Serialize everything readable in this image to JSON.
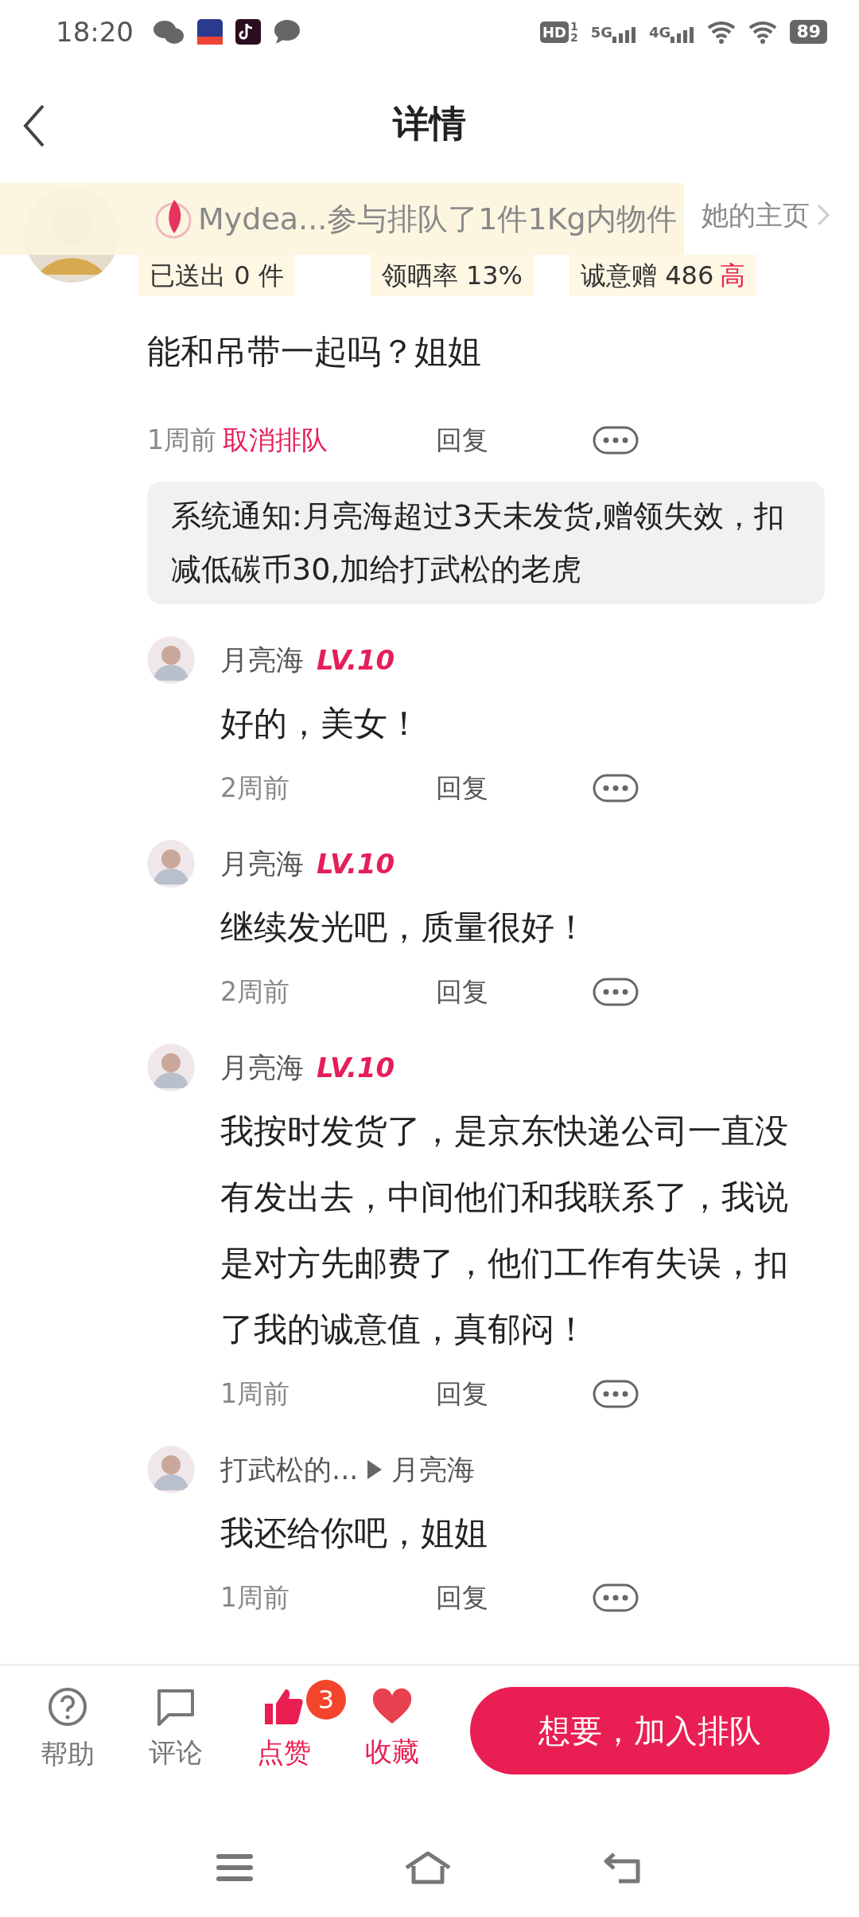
{
  "status_bar": {
    "time": "18:20",
    "hd": {
      "label": "HD",
      "sims": [
        "1",
        "2"
      ]
    },
    "networks": [
      "5G",
      "4G"
    ],
    "battery": "89"
  },
  "header": {
    "title": "详情"
  },
  "poster": {
    "home_link": "她的主页",
    "stats": [
      {
        "label": "已送出 0 件"
      },
      {
        "label": "领晒率 13%"
      },
      {
        "label": "诚意赠 486",
        "tag": "高"
      }
    ]
  },
  "banner": {
    "text": "Mydea...参与排队了1件1Kg内物件"
  },
  "post": {
    "text": "能和吊带一起吗？姐姐",
    "time": "1周前",
    "cancel": "取消排队",
    "reply": "回复"
  },
  "notice": {
    "text": "系统通知:月亮海超过3天未发货,赠领失效，扣减低碳币30,加给打武松的老虎"
  },
  "replies": [
    {
      "name": "月亮海",
      "level": "LV.10",
      "text": "好的，美女！",
      "time": "2周前",
      "reply": "回复"
    },
    {
      "name": "月亮海",
      "level": "LV.10",
      "text": "继续发光吧，质量很好！",
      "time": "2周前",
      "reply": "回复"
    },
    {
      "name": "月亮海",
      "level": "LV.10",
      "text": "我按时发货了，是京东快递公司一直没有发出去，中间他们和我联系了，我说是对方先邮费了，他们工作有失误，扣了我的诚意值，真郁闷！",
      "time": "1周前",
      "reply": "回复"
    },
    {
      "name": "打武松的...",
      "to": "月亮海",
      "text": "我还给你吧，姐姐",
      "time": "1周前",
      "reply": "回复"
    }
  ],
  "bottom_bar": {
    "actions": [
      {
        "kind": "help",
        "label": "帮助",
        "active": false
      },
      {
        "kind": "comment",
        "label": "评论",
        "active": false
      },
      {
        "kind": "like",
        "label": "点赞",
        "active": true,
        "count": "3"
      },
      {
        "kind": "favorite",
        "label": "收藏",
        "active": true
      }
    ],
    "primary_button": "想要，加入排队"
  }
}
